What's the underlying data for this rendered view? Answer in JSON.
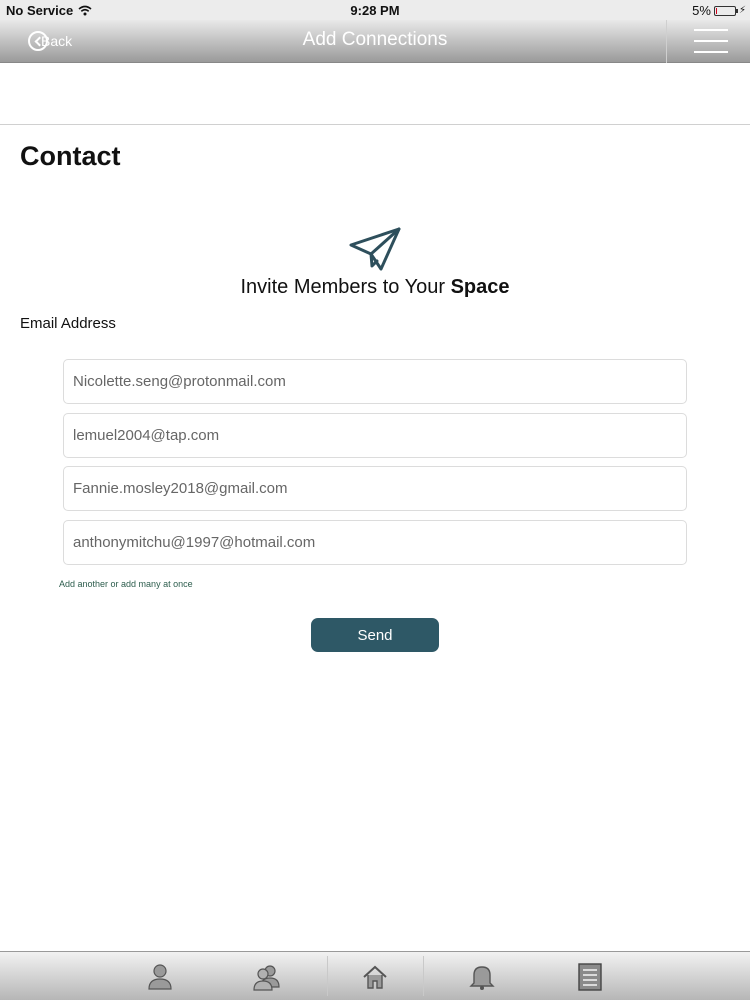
{
  "status_bar": {
    "carrier": "No Service",
    "time": "9:28 PM",
    "battery_text": "5%",
    "battery_level": 0.05
  },
  "nav": {
    "back_label": "Back",
    "title": "Add Connections"
  },
  "page": {
    "title": "Contact",
    "invite_text": "Invite Members to Your ",
    "invite_bold": "Space",
    "email_label": "Email Address",
    "emails": [
      "Nicolette.seng@protonmail.com",
      "lemuel2004@tap.com",
      "Fannie.mosley2018@gmail.com",
      "anthonymitchu@1997@hotmail.com"
    ],
    "add_another": "Add another or add many at once",
    "send_label": "Send"
  },
  "tab_bar": {
    "items": [
      "profile-icon",
      "connections-icon",
      "home-icon",
      "bell-icon",
      "list-icon"
    ]
  },
  "colors": {
    "accent": "#2e5866",
    "link": "#2e5e4e",
    "plane": "#2e4f5c"
  }
}
